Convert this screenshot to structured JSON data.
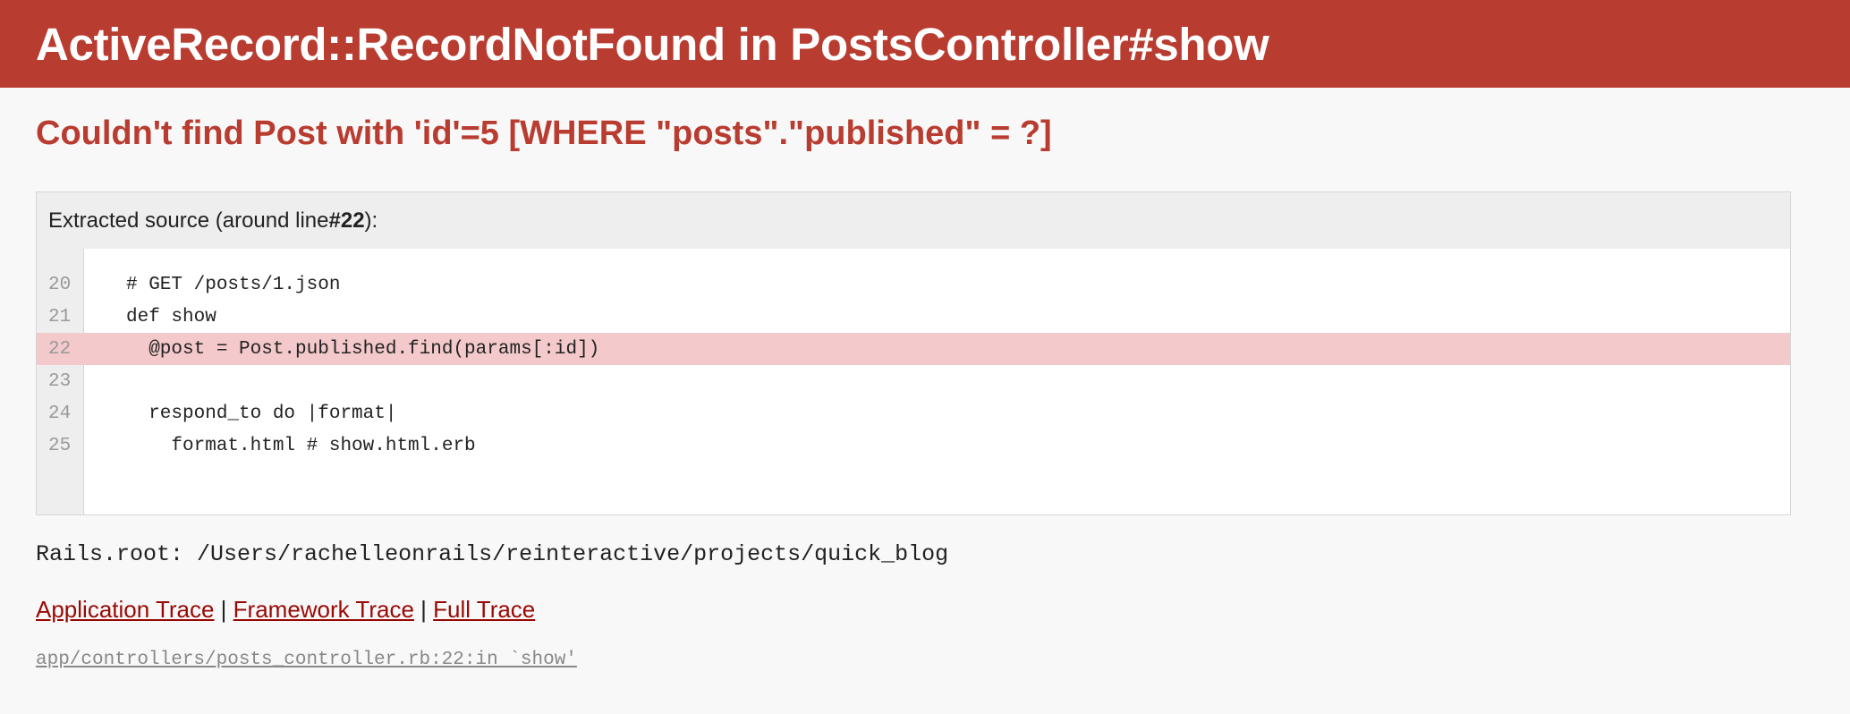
{
  "header": {
    "title": "ActiveRecord::RecordNotFound in PostsController#show"
  },
  "error": {
    "message": "Couldn't find Post with 'id'=5 [WHERE \"posts\".\"published\" = ?]"
  },
  "source": {
    "title_prefix": "Extracted source (around line ",
    "title_line": "#22",
    "title_suffix": "):",
    "lines": [
      {
        "number": "20",
        "code": "# GET /posts/1.json",
        "highlight": false
      },
      {
        "number": "21",
        "code": "def show",
        "highlight": false
      },
      {
        "number": "22",
        "code": "  @post = Post.published.find(params[:id])",
        "highlight": true
      },
      {
        "number": "23",
        "code": "",
        "highlight": false
      },
      {
        "number": "24",
        "code": "  respond_to do |format|",
        "highlight": false
      },
      {
        "number": "25",
        "code": "    format.html # show.html.erb",
        "highlight": false
      }
    ]
  },
  "rails_root": "Rails.root: /Users/rachelleonrails/reinteractive/projects/quick_blog",
  "trace": {
    "links": [
      {
        "name": "application-trace-link",
        "label": "Application Trace"
      },
      {
        "name": "framework-trace-link",
        "label": "Framework Trace"
      },
      {
        "name": "full-trace-link",
        "label": "Full Trace"
      }
    ],
    "separator": " | ",
    "first_line": "app/controllers/posts_controller.rb:22:in `show'"
  },
  "colors": {
    "header_bg": "#b93c31",
    "error_text": "#b93c31",
    "highlight_bg": "#f4c9cb",
    "link": "#980905"
  }
}
